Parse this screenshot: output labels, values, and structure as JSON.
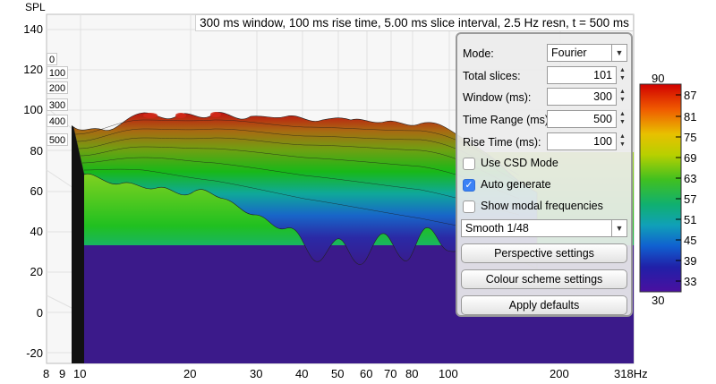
{
  "title": "300 ms window, 100 ms rise time, 5.00 ms slice interval, 2.5 Hz resn, t = 500 ms",
  "axis": {
    "y_label": "SPL",
    "y_ticks": [
      "140",
      "120",
      "100",
      "80",
      "60",
      "40",
      "20",
      "0",
      "-20"
    ],
    "x_ticks": [
      "8",
      "9",
      "10",
      "20",
      "30",
      "40",
      "50",
      "60",
      "70",
      "80",
      "100",
      "200",
      "318Hz"
    ],
    "z_ticks": [
      "0",
      "100",
      "200",
      "300",
      "400",
      "500"
    ]
  },
  "panel": {
    "mode_label": "Mode:",
    "mode_value": "Fourier",
    "total_slices_label": "Total slices:",
    "total_slices_value": "101",
    "window_label": "Window (ms):",
    "window_value": "300",
    "time_range_label": "Time Range (ms):",
    "time_range_value": "500",
    "rise_time_label": "Rise Time (ms):",
    "rise_time_value": "100",
    "use_csd_label": "Use CSD Mode",
    "use_csd_checked": false,
    "auto_generate_label": "Auto generate",
    "auto_generate_checked": true,
    "show_modal_label": "Show modal frequencies",
    "show_modal_checked": false,
    "smoothing_value": "Smooth 1/48",
    "perspective_button": "Perspective settings",
    "colour_scheme_button": "Colour scheme settings",
    "apply_defaults_button": "Apply defaults"
  },
  "color_scale": {
    "top_label": "90",
    "bottom_label": "30",
    "labels": [
      "87",
      "81",
      "75",
      "69",
      "63",
      "57",
      "51",
      "45",
      "39",
      "33"
    ]
  }
}
